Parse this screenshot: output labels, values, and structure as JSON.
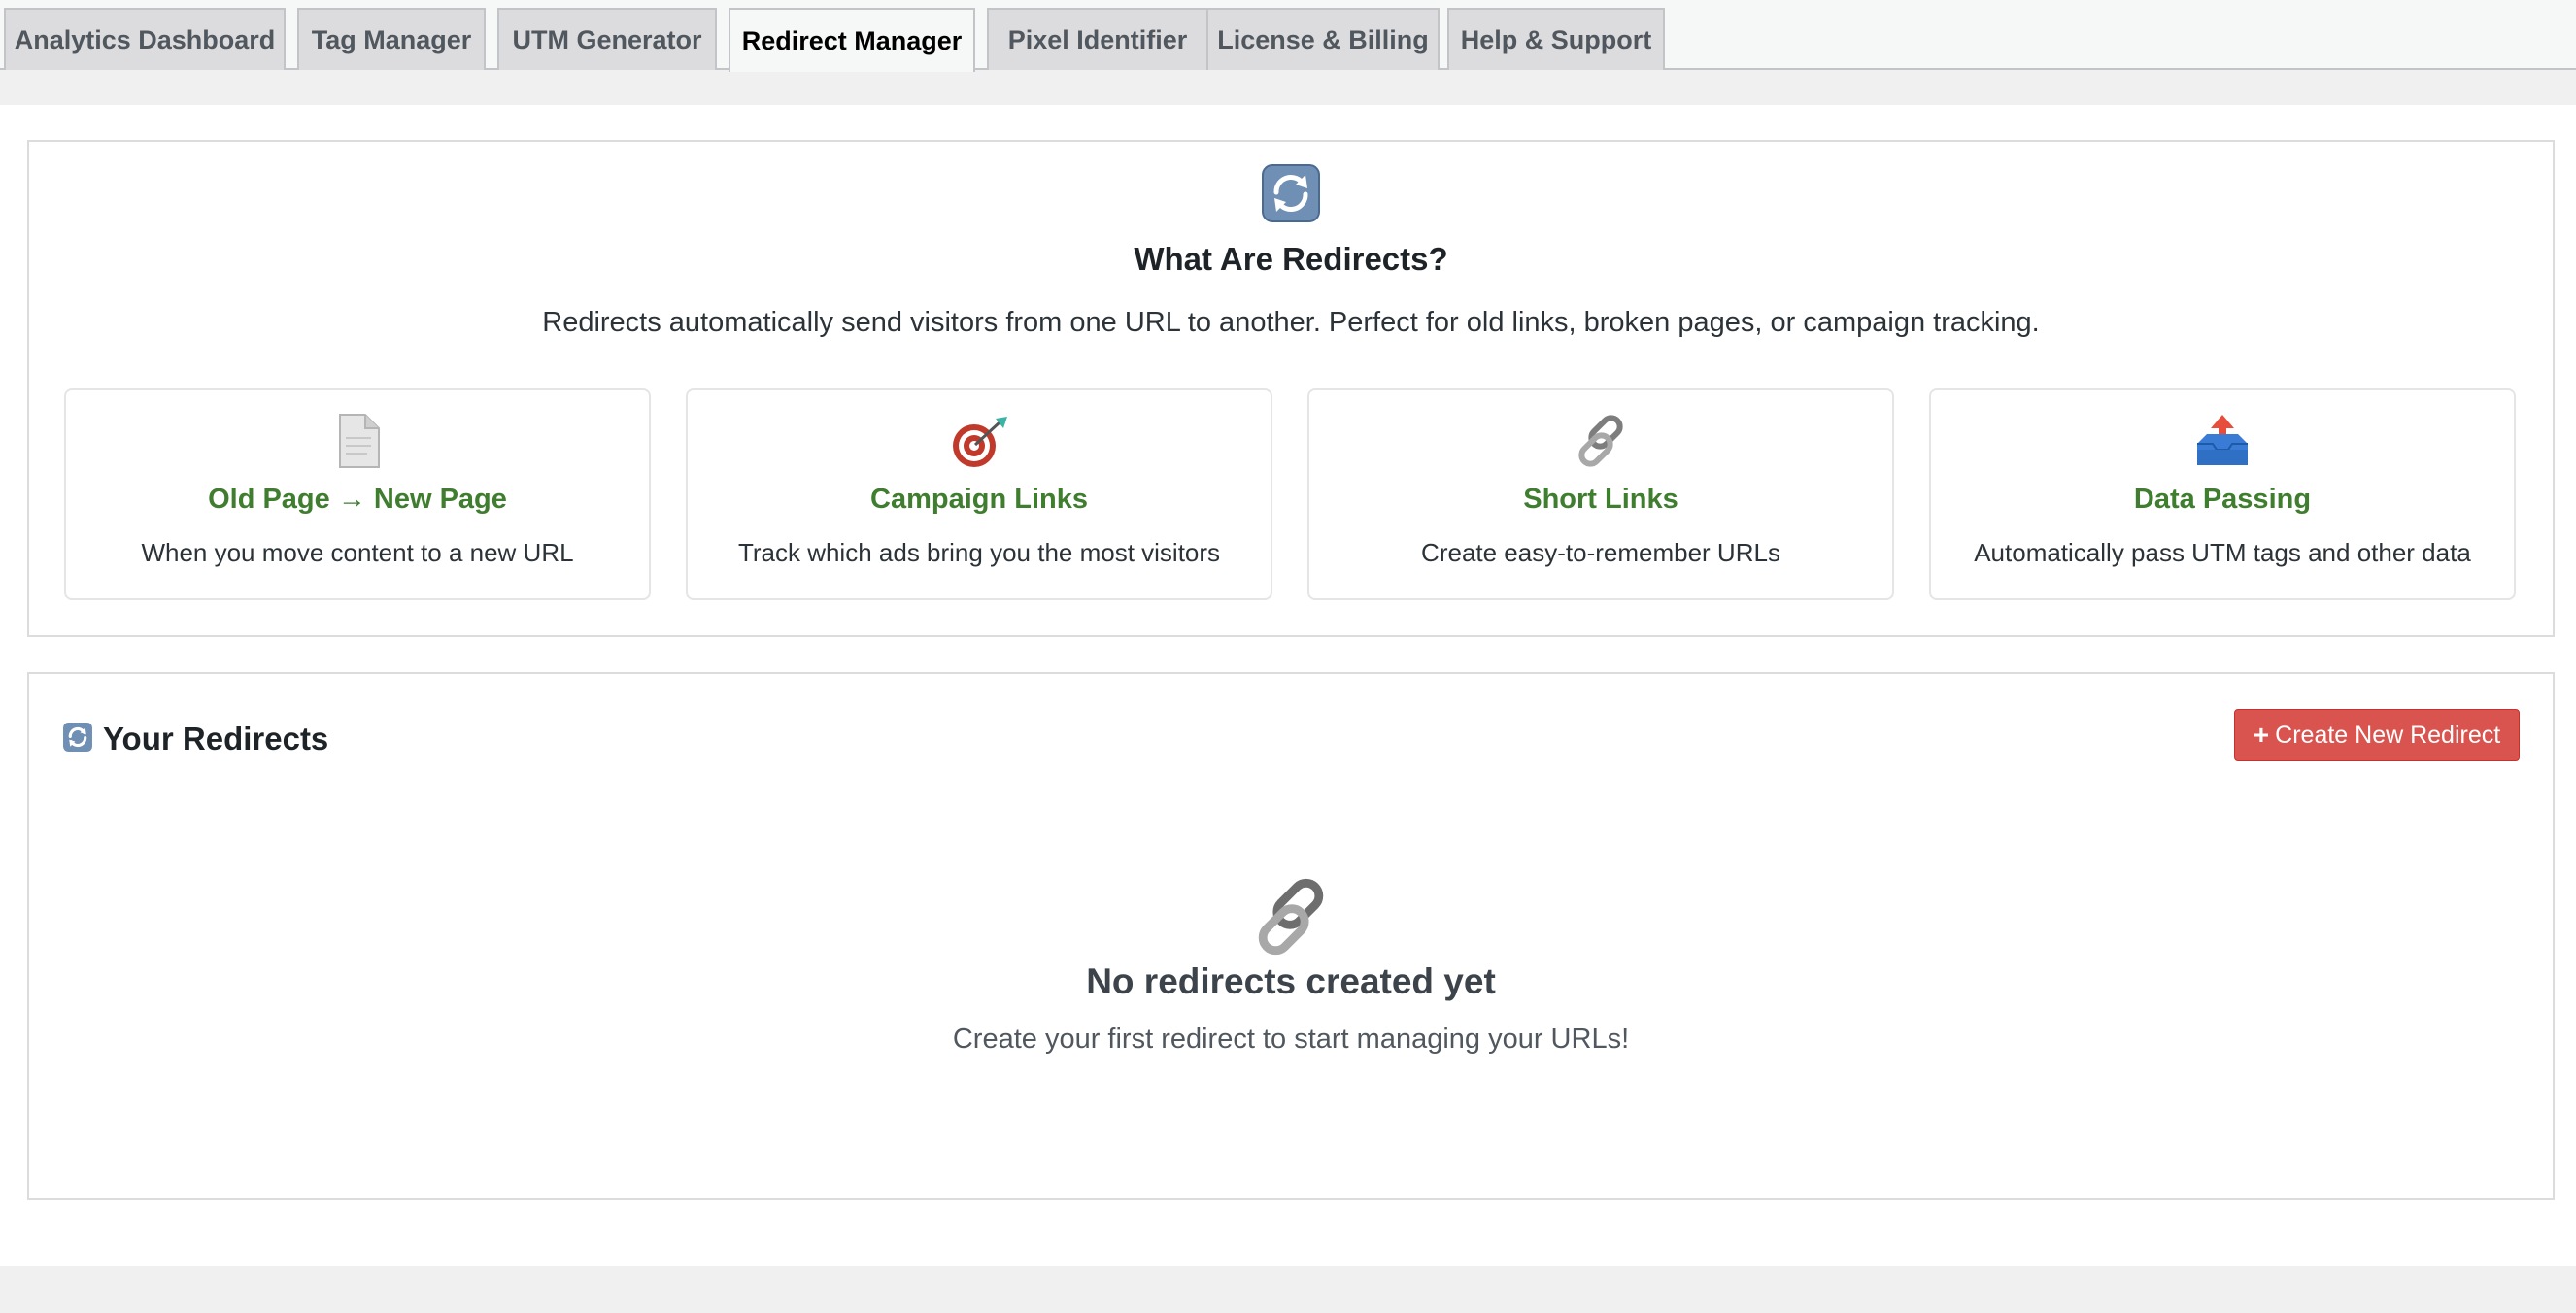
{
  "tabs": [
    {
      "label": "Analytics Dashboard"
    },
    {
      "label": "Tag Manager"
    },
    {
      "label": "UTM Generator"
    },
    {
      "label": "Redirect Manager",
      "active": true
    },
    {
      "label": "Pixel Identifier"
    },
    {
      "label": "License & Billing"
    },
    {
      "label": "Help & Support"
    }
  ],
  "intro": {
    "icon": "refresh-arrows-icon",
    "title": "What Are Redirects?",
    "description": "Redirects automatically send visitors from one URL to another. Perfect for old links, broken pages, or campaign tracking.",
    "cards": [
      {
        "icon": "page-document-icon",
        "title": "Old Page → New Page",
        "description": "When you move content to a new URL"
      },
      {
        "icon": "target-dart-icon",
        "title": "Campaign Links",
        "description": "Track which ads bring you the most visitors"
      },
      {
        "icon": "chain-link-icon",
        "title": "Short Links",
        "description": "Create easy-to-remember URLs"
      },
      {
        "icon": "outbox-tray-icon",
        "title": "Data Passing",
        "description": "Automatically pass UTM tags and other data"
      }
    ]
  },
  "redirects": {
    "icon": "refresh-arrows-icon",
    "title": "Your Redirects",
    "create_button": "Create New Redirect",
    "empty_icon": "chain-link-icon",
    "empty_title": "No redirects created yet",
    "empty_description": "Create your first redirect to start managing your URLs!"
  },
  "colors": {
    "accent_green": "#3f7d2f",
    "create_button": "#d9534f"
  }
}
